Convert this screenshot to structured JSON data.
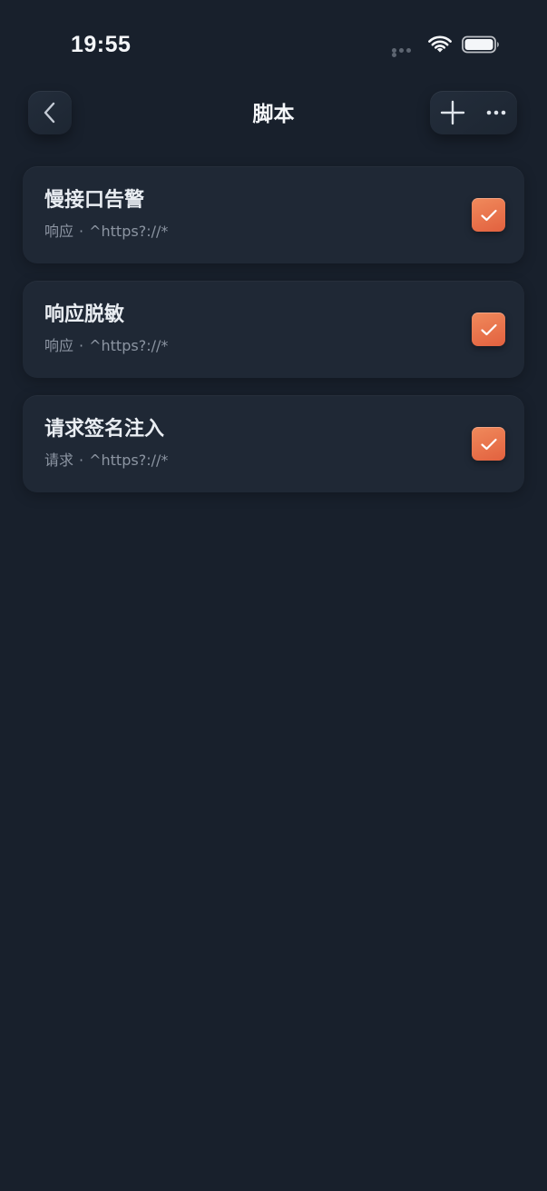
{
  "status_bar": {
    "time": "19:55",
    "signal_icon": "signal-dots-icon",
    "wifi_icon": "wifi-icon",
    "battery_icon": "battery-icon"
  },
  "nav": {
    "title": "脚本",
    "back_icon": "chevron-left-icon",
    "add_icon": "plus-icon",
    "more_icon": "ellipsis-icon"
  },
  "scripts": [
    {
      "name": "慢接口告警",
      "type": "响应",
      "separator": "·",
      "pattern": "^https?://*",
      "enabled": true
    },
    {
      "name": "响应脱敏",
      "type": "响应",
      "separator": "·",
      "pattern": "^https?://*",
      "enabled": true
    },
    {
      "name": "请求签名注入",
      "type": "请求",
      "separator": "·",
      "pattern": "^https?://*",
      "enabled": true
    }
  ],
  "colors": {
    "background": "#18202c",
    "card": "#1f2835",
    "accent": "#e8704a",
    "text_primary": "#e9edf2",
    "text_secondary": "#8c95a2"
  }
}
